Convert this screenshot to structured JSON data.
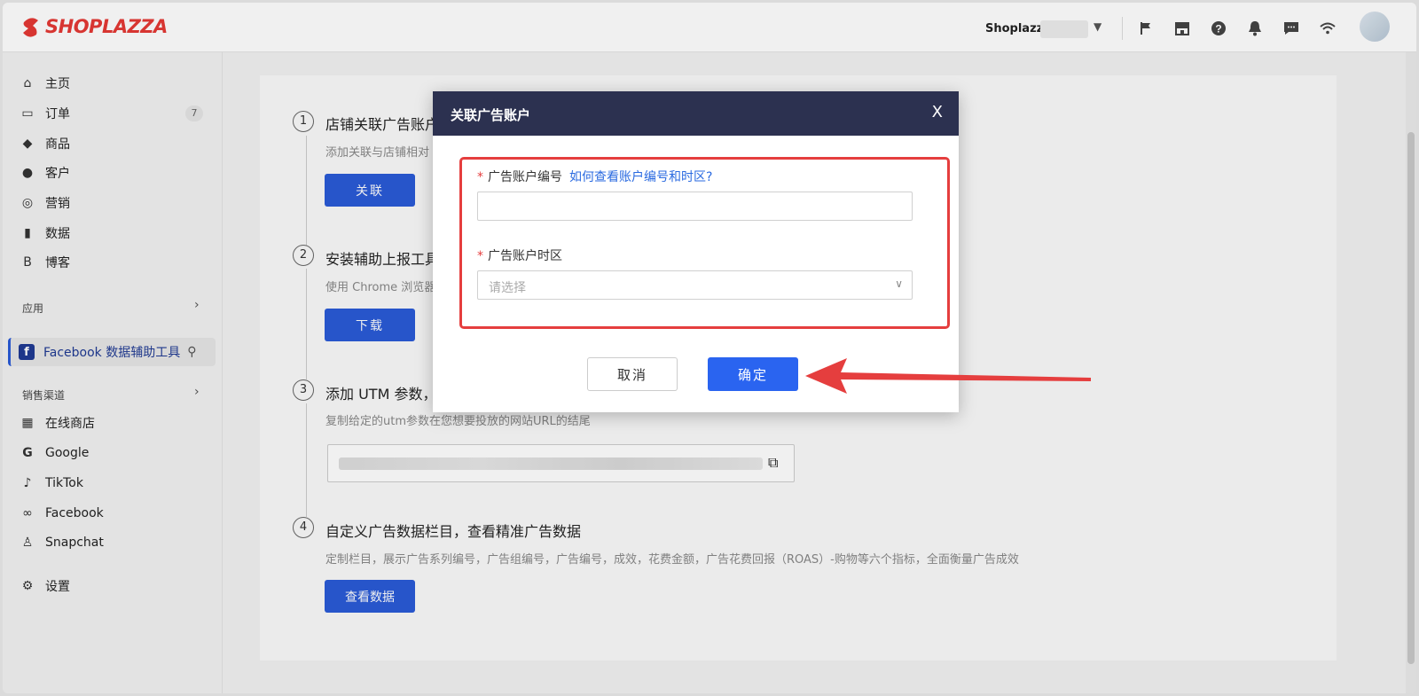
{
  "app": {
    "logo_text": "SHOPLAZZA",
    "store_name": "Shoplazza"
  },
  "top_icons": [
    "flag-icon",
    "store-icon",
    "help-icon",
    "bell-icon",
    "chat-icon",
    "wifi-icon"
  ],
  "sidebar": {
    "items": [
      {
        "label": "主页",
        "icon": "home-icon"
      },
      {
        "label": "订单",
        "icon": "inbox-icon",
        "badge": "7"
      },
      {
        "label": "商品",
        "icon": "tag-icon"
      },
      {
        "label": "客户",
        "icon": "user-icon"
      },
      {
        "label": "营销",
        "icon": "marketing-icon"
      },
      {
        "label": "数据",
        "icon": "chart-icon"
      },
      {
        "label": "博客",
        "icon": "blog-icon"
      }
    ],
    "apps_label": "应用",
    "active_app": "Facebook 数据辅助工具",
    "channels_label": "销售渠道",
    "channels": [
      {
        "label": "在线商店",
        "icon": "store-icon"
      },
      {
        "label": "Google",
        "icon": "google-icon"
      },
      {
        "label": "TikTok",
        "icon": "tiktok-icon"
      },
      {
        "label": "Facebook",
        "icon": "meta-icon"
      },
      {
        "label": "Snapchat",
        "icon": "snapchat-icon"
      }
    ],
    "settings_label": "设置"
  },
  "main": {
    "steps": [
      {
        "num": "1",
        "title": "店铺关联广告账户",
        "desc": "添加关联与店铺相对",
        "button": "关联"
      },
      {
        "num": "2",
        "title": "安装辅助上报工具",
        "desc": "使用 Chrome 浏览器",
        "button": "下载"
      },
      {
        "num": "3",
        "title": "添加 UTM 参数，",
        "desc": "复制给定的utm参数在您想要投放的网站URL的结尾"
      },
      {
        "num": "4",
        "title": "自定义广告数据栏目，查看精准广告数据",
        "desc": "定制栏目，展示广告系列编号，广告组编号，广告编号，成效，花费金额，广告花费回报（ROAS）-购物等六个指标，全面衡量广告成效",
        "button": "查看数据"
      }
    ]
  },
  "modal": {
    "title": "关联广告账户",
    "close": "X",
    "account_label": "广告账户编号",
    "help_link": "如何查看账户编号和时区?",
    "account_value": "",
    "timezone_label": "广告账户时区",
    "timezone_placeholder": "请选择",
    "cancel": "取消",
    "confirm": "确定"
  },
  "colors": {
    "primary": "#2a5bd7",
    "modal_header": "#2c3150",
    "highlight": "#e53e3e",
    "brand": "#e53935"
  }
}
